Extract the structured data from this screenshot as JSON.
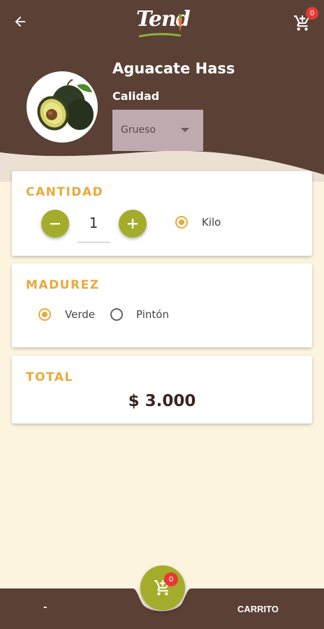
{
  "colors": {
    "brown": "#5b4035",
    "olive": "#a4ac2c",
    "accent": "#e8a93d",
    "cream": "#fcf4df",
    "badge": "#e53935"
  },
  "header": {
    "logo_text": "Tend",
    "cart_count": "0"
  },
  "product": {
    "name": "Aguacate Hass",
    "quality_label": "Calidad",
    "quality_value": "Grueso"
  },
  "quantity": {
    "title": "CANTIDAD",
    "value": "1",
    "unit_label": "Kilo",
    "unit_selected": true
  },
  "ripeness": {
    "title": "MADUREZ",
    "options": [
      {
        "label": "Verde",
        "selected": true
      },
      {
        "label": "Pintón",
        "selected": false
      }
    ]
  },
  "total": {
    "title": "TOTAL",
    "value": "$ 3.000"
  },
  "bottom_nav": {
    "left_label": "-",
    "right_label": "CARRITO",
    "cart_count": "0"
  }
}
